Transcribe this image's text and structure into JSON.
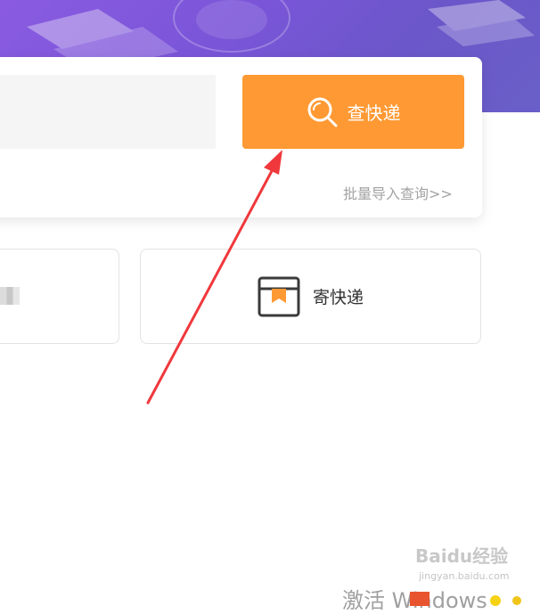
{
  "search": {
    "placeholder": "",
    "button_label": "查快递",
    "batch_link": "批量导入查询>>"
  },
  "actions": {
    "send_label": "寄快递"
  },
  "watermark": {
    "activation_text": "激活 Windows",
    "baidu_text": "Baidu经验",
    "baidu_url": "jingyan.baidu.com"
  },
  "colors": {
    "accent": "#ff9933",
    "hero_purple": "#7a55d8",
    "annotation_arrow": "#f0383c"
  },
  "icons": {
    "search_button_icon": "magnifier-icon",
    "send_card_icon": "package-box-icon"
  }
}
